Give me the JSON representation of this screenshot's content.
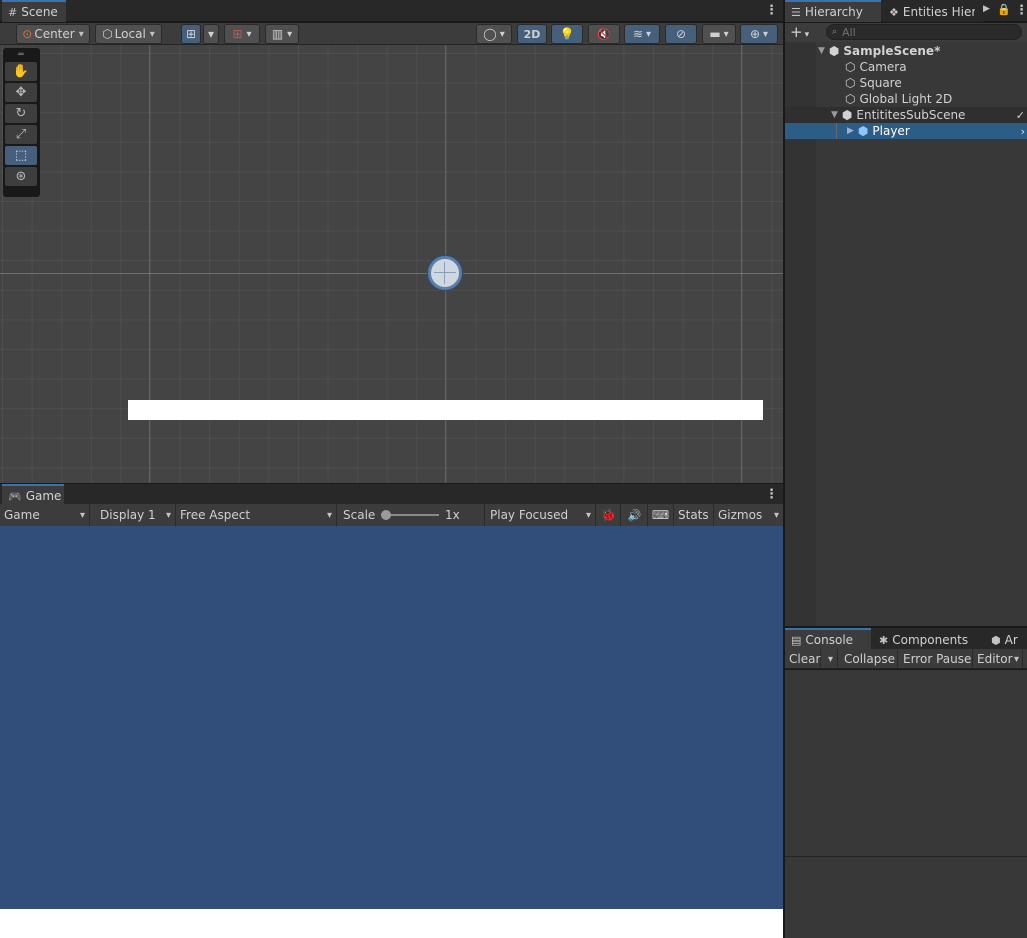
{
  "scene_tab": {
    "title": "Scene",
    "icon": "grid-icon"
  },
  "scene_toolbar": {
    "pivot_mode": "Center",
    "pivot_rotation": "Local",
    "btn_2d": "2D"
  },
  "tools": [
    "hand-icon",
    "move-icon",
    "rotate-icon",
    "scale-icon",
    "rect-icon",
    "transform-icon"
  ],
  "game_tab": {
    "title": "Game",
    "icon": "gamepad-icon"
  },
  "game_toolbar": {
    "mode": "Game",
    "display": "Display 1",
    "aspect": "Free Aspect",
    "scale_label": "Scale",
    "scale_value": "1x",
    "play_mode": "Play Focused",
    "stats": "Stats",
    "gizmos": "Gizmos"
  },
  "colors": {
    "game_bg": "#314d79",
    "selection": "#2c5d87",
    "accent_tab": "#3a72b0"
  },
  "hierarchy": {
    "tab_title": "Hierarchy",
    "tab2_title": "Entities Hiera",
    "search_placeholder": "All",
    "add_label": "+",
    "items": [
      {
        "label": "SampleScene*",
        "depth": 0,
        "kind": "scene"
      },
      {
        "label": "Camera",
        "depth": 1,
        "kind": "object"
      },
      {
        "label": "Square",
        "depth": 1,
        "kind": "object"
      },
      {
        "label": "Global Light 2D",
        "depth": 1,
        "kind": "object"
      },
      {
        "label": "EntititesSubScene",
        "depth": 1,
        "kind": "subscene"
      },
      {
        "label": "Player",
        "depth": 2,
        "kind": "prefab",
        "selected": true
      }
    ]
  },
  "console": {
    "tab_title": "Console",
    "tab2_title": "Components",
    "tab3_title": "Ar",
    "clear": "Clear",
    "collapse": "Collapse",
    "error_pause": "Error Pause",
    "editor": "Editor"
  }
}
